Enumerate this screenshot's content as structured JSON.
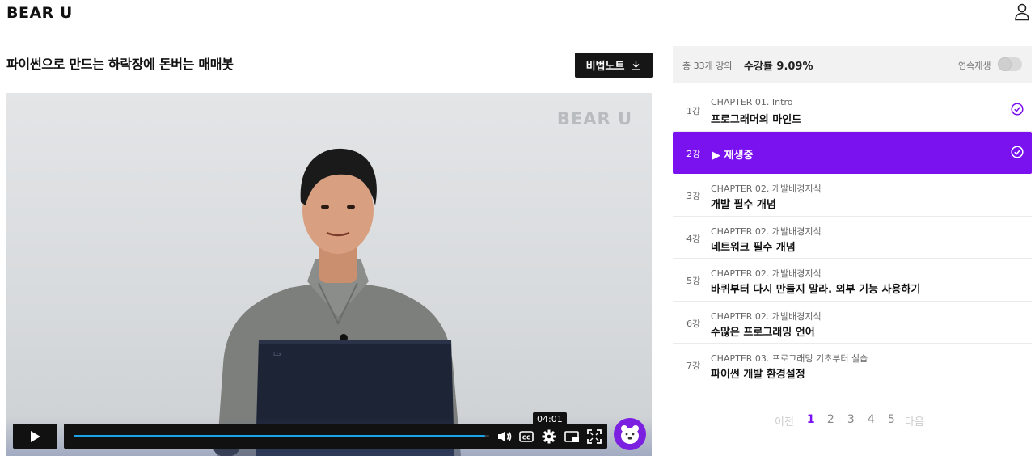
{
  "header": {
    "logo_text": "BEAR U",
    "user_icon": "user-icon"
  },
  "course": {
    "title": "파이썬으로 만드는 하락장에 돈버는 매매봇",
    "notes_button_label": "비법노트",
    "notes_button_icon": "download-icon"
  },
  "video": {
    "watermark": "BEAR U",
    "time_tooltip": "04:01",
    "progress_fraction": 0.99,
    "accent_color": "#1aa3e8",
    "controls": [
      "play-icon",
      "volume-icon",
      "captions-icon",
      "settings-icon",
      "pip-icon",
      "fullscreen-icon"
    ]
  },
  "summary": {
    "total_label": "총 33개 강의",
    "rate_label": "수강률 9.09%",
    "autoplay_label": "연속재생",
    "autoplay_on": false
  },
  "lessons": [
    {
      "num": "1강",
      "chapter": "CHAPTER 01. Intro",
      "name": "프로그래머의 마인드",
      "completed": true
    },
    {
      "num": "2강",
      "playing_label": "▶ 재생중",
      "active": true,
      "completed": true
    },
    {
      "num": "3강",
      "chapter": "CHAPTER 02. 개발배경지식",
      "name": "개발 필수 개념"
    },
    {
      "num": "4강",
      "chapter": "CHAPTER 02. 개발배경지식",
      "name": "네트워크 필수 개념"
    },
    {
      "num": "5강",
      "chapter": "CHAPTER 02. 개발배경지식",
      "name": "바퀴부터 다시 만들지 말라. 외부 기능 사용하기"
    },
    {
      "num": "6강",
      "chapter": "CHAPTER 02. 개발배경지식",
      "name": "수많은 프로그래밍 언어"
    },
    {
      "num": "7강",
      "chapter": "CHAPTER 03. 프로그래밍 기초부터 실습",
      "name": "파이썬 개발 환경설정"
    }
  ],
  "pagination": {
    "prev": "이전",
    "pages": [
      "1",
      "2",
      "3",
      "4",
      "5"
    ],
    "current": "1",
    "next": "다음"
  },
  "colors": {
    "brand": "#7a12f0",
    "dark": "#161616"
  }
}
